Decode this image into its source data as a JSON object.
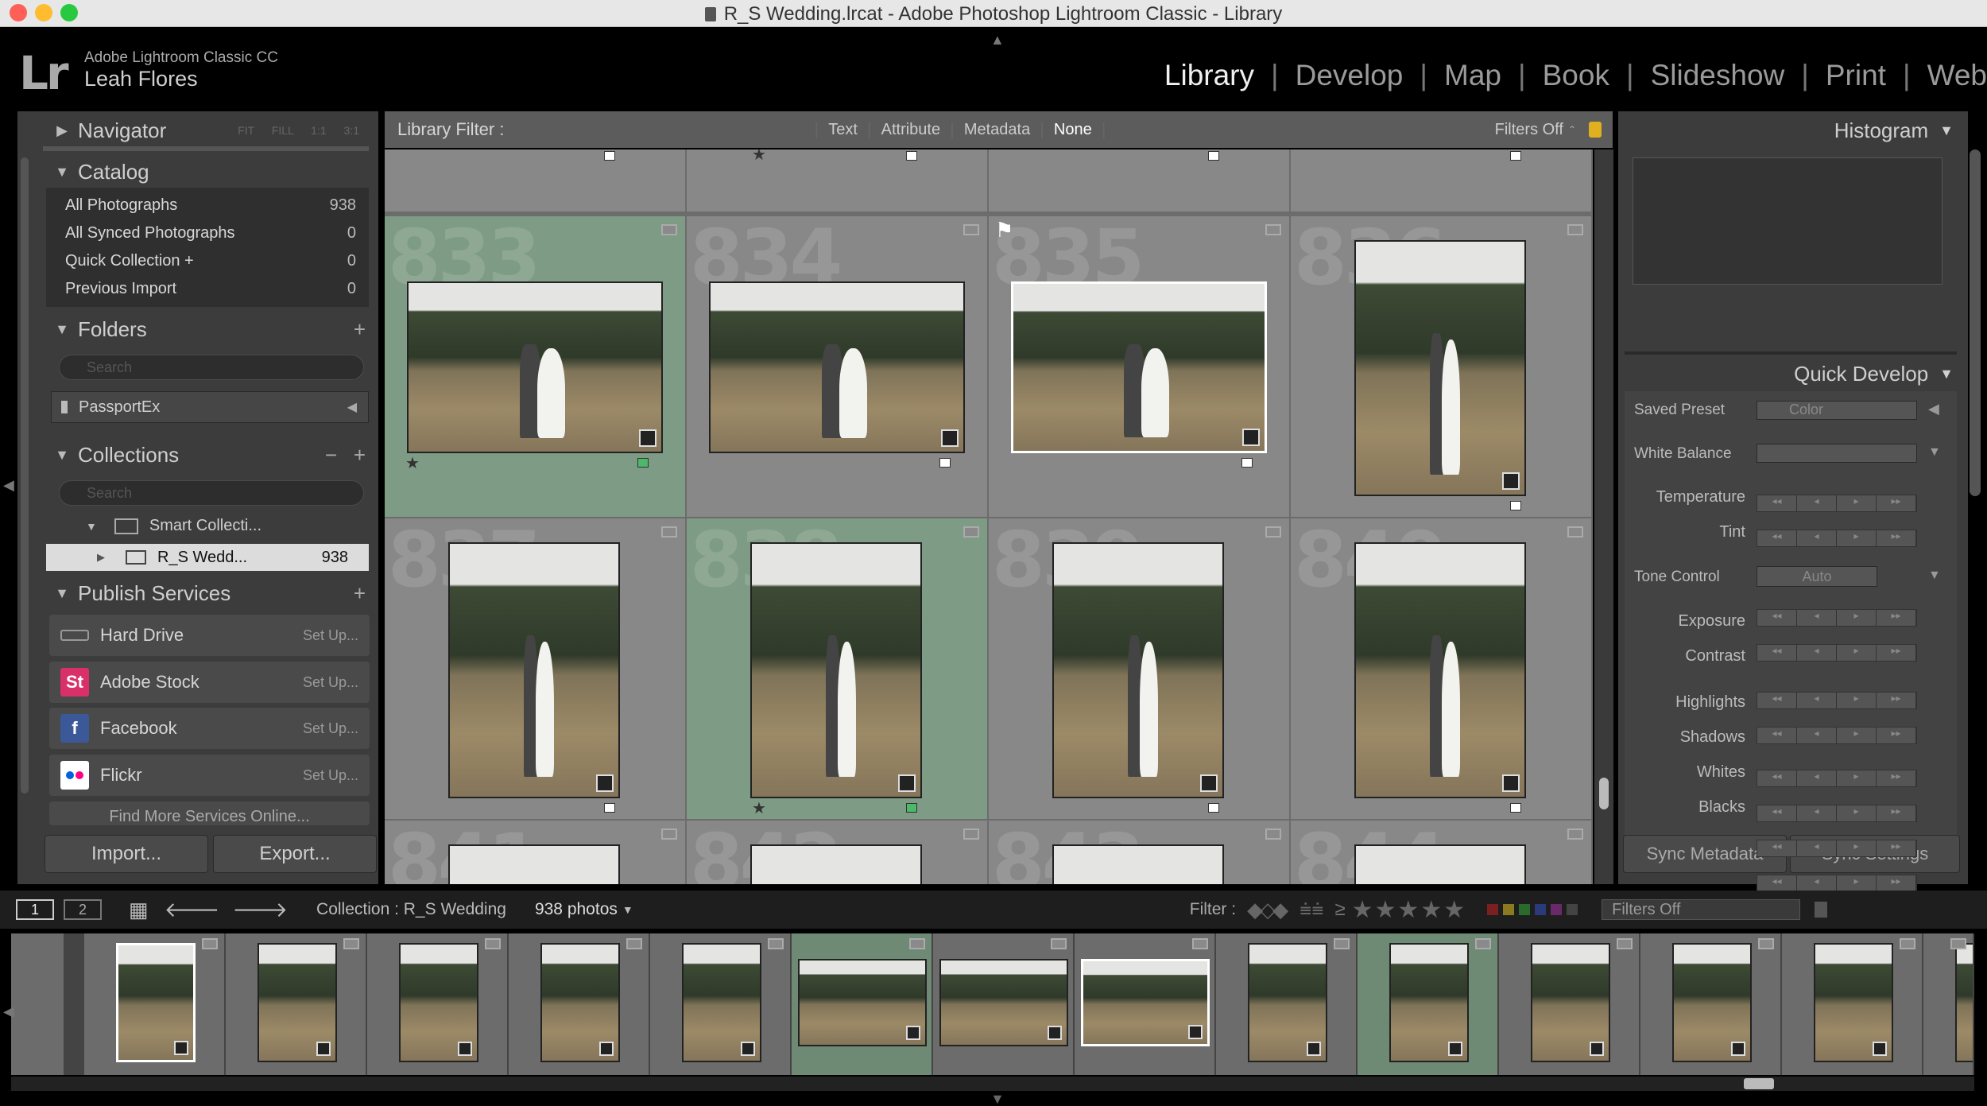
{
  "window": {
    "title": "R_S Wedding.lrcat - Adobe Photoshop Lightroom Classic - Library"
  },
  "identity": {
    "logo": "Lr",
    "product": "Adobe Lightroom Classic CC",
    "user": "Leah Flores"
  },
  "modules": [
    "Library",
    "Develop",
    "Map",
    "Book",
    "Slideshow",
    "Print",
    "Web"
  ],
  "left": {
    "navigator": {
      "title": "Navigator",
      "zooms": [
        "FIT",
        "FILL",
        "1:1",
        "3:1"
      ]
    },
    "catalog": {
      "title": "Catalog",
      "items": [
        {
          "label": "All Photographs",
          "count": "938"
        },
        {
          "label": "All Synced Photographs",
          "count": "0"
        },
        {
          "label": "Quick Collection  +",
          "count": "0"
        },
        {
          "label": "Previous Import",
          "count": "0"
        }
      ]
    },
    "folders": {
      "title": "Folders",
      "search_placeholder": "Search",
      "drive": "PassportEx"
    },
    "collections": {
      "title": "Collections",
      "search_placeholder": "Search",
      "smart": "Smart Collecti...",
      "item": "R_S Wedd...",
      "item_count": "938"
    },
    "publish": {
      "title": "Publish Services",
      "services": [
        {
          "label": "Hard Drive",
          "action": "Set Up..."
        },
        {
          "label": "Adobe Stock",
          "action": "Set Up..."
        },
        {
          "label": "Facebook",
          "action": "Set Up..."
        },
        {
          "label": "Flickr",
          "action": "Set Up..."
        }
      ],
      "more": "Find More Services Online..."
    },
    "import": "Import...",
    "export": "Export..."
  },
  "filter": {
    "label": "Library Filter :",
    "tabs": [
      "Text",
      "Attribute",
      "Metadata",
      "None"
    ],
    "active": "None",
    "state": "Filters Off"
  },
  "grid": {
    "rows": [
      [
        {
          "num": "833",
          "sel": true
        },
        {
          "num": "834",
          "sel": false
        },
        {
          "num": "835",
          "sel": false
        },
        {
          "num": "836",
          "sel": false
        }
      ],
      [
        {
          "num": "837",
          "sel": false
        },
        {
          "num": "838",
          "sel": true
        },
        {
          "num": "839",
          "sel": false
        },
        {
          "num": "840",
          "sel": false
        }
      ]
    ],
    "next_row": [
      "841",
      "842",
      "843",
      "844"
    ]
  },
  "right": {
    "histogram": "Histogram",
    "quick_develop": {
      "title": "Quick Develop",
      "saved_preset_label": "Saved Preset",
      "saved_preset": "Color",
      "white_balance": "White Balance",
      "temperature": "Temperature",
      "tint": "Tint",
      "tone_control": "Tone Control",
      "auto": "Auto",
      "exposure": "Exposure",
      "contrast": "Contrast",
      "highlights": "Highlights",
      "shadows": "Shadows",
      "whites": "Whites",
      "blacks": "Blacks"
    },
    "sync_metadata": "Sync Metadata",
    "sync_settings": "Sync Settings"
  },
  "filmstrip": {
    "view1": "1",
    "view2": "2",
    "source": "Collection : R_S Wedding",
    "count": "938 photos",
    "filter_label": "Filter :",
    "filter_state": "Filters Off"
  }
}
